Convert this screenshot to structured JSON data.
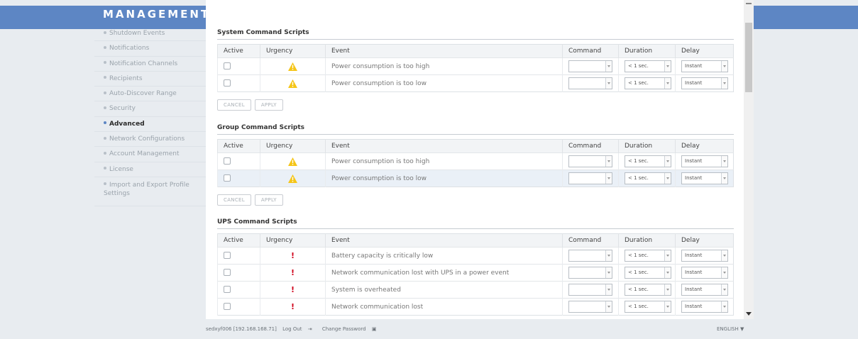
{
  "app": {
    "title": "MANAGEMENT"
  },
  "colors": {
    "header_band": "#5d86c4",
    "warning": "#f5c518",
    "critical": "#d0021b",
    "highlight_row": "#eaf0f7"
  },
  "sidebar": {
    "items": [
      {
        "label": "Shutdown Events",
        "active": false
      },
      {
        "label": "Notifications",
        "active": false
      },
      {
        "label": "Notification Channels",
        "active": false
      },
      {
        "label": "Recipients",
        "active": false
      },
      {
        "label": "Auto-Discover Range",
        "active": false
      },
      {
        "label": "Security",
        "active": false
      },
      {
        "label": "Advanced",
        "active": true
      },
      {
        "label": "Network Configurations",
        "active": false
      },
      {
        "label": "Account Management",
        "active": false
      },
      {
        "label": "License",
        "active": false
      },
      {
        "label": "Import and Export Profile Settings",
        "active": false
      }
    ]
  },
  "columns": {
    "active": "Active",
    "urgency": "Urgency",
    "event": "Event",
    "command": "Command",
    "duration": "Duration",
    "delay": "Delay"
  },
  "buttons": {
    "cancel": "CANCEL",
    "apply": "APPLY"
  },
  "system_scripts": {
    "title": "System Command Scripts",
    "rows": [
      {
        "urgency_icon": "warning-icon",
        "event": "Power consumption is too high",
        "command": "",
        "duration": "< 1 sec.",
        "delay": "Instant",
        "active": false
      },
      {
        "urgency_icon": "warning-icon",
        "event": "Power consumption is too low",
        "command": "",
        "duration": "< 1 sec.",
        "delay": "Instant",
        "active": false
      }
    ]
  },
  "group_scripts": {
    "title": "Group Command Scripts",
    "rows": [
      {
        "urgency_icon": "warning-icon",
        "event": "Power consumption is too high",
        "command": "",
        "duration": "< 1 sec.",
        "delay": "Instant",
        "active": false
      },
      {
        "urgency_icon": "warning-icon",
        "event": "Power consumption is too low",
        "command": "",
        "duration": "< 1 sec.",
        "delay": "Instant",
        "active": false
      }
    ]
  },
  "ups_scripts": {
    "title": "UPS Command Scripts",
    "rows": [
      {
        "urgency_icon": "critical-icon",
        "urgency_glyph": "!",
        "event": "Battery capacity is critically low",
        "command": "",
        "duration": "< 1 sec.",
        "delay": "Instant",
        "active": false
      },
      {
        "urgency_icon": "critical-icon",
        "urgency_glyph": "!",
        "event": "Network communication lost with UPS in a power event",
        "command": "",
        "duration": "< 1 sec.",
        "delay": "Instant",
        "active": false
      },
      {
        "urgency_icon": "critical-icon",
        "urgency_glyph": "!",
        "event": "System is overheated",
        "command": "",
        "duration": "< 1 sec.",
        "delay": "Instant",
        "active": false
      },
      {
        "urgency_icon": "critical-icon",
        "urgency_glyph": "!",
        "event": "Network communication lost",
        "command": "",
        "duration": "< 1 sec.",
        "delay": "Instant",
        "active": false
      }
    ]
  },
  "footer": {
    "user": "sedxyf006 [192.168.168.71]",
    "logout": "Log Out",
    "logout_icon": "logout-icon",
    "change_password": "Change Password",
    "lock_icon": "lock-icon",
    "language": "ENGLISH"
  }
}
